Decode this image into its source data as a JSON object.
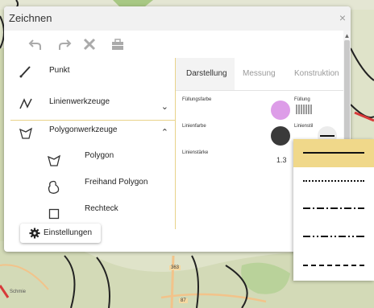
{
  "window": {
    "title": "Zeichnen",
    "close_glyph": "×"
  },
  "toolbar": [
    {
      "name": "undo-icon"
    },
    {
      "name": "redo-icon"
    },
    {
      "name": "delete-icon"
    },
    {
      "name": "toolbox-icon"
    }
  ],
  "tools": {
    "punkt": "Punkt",
    "linien": "Linienwerkzeuge",
    "polygon": "Polygonwerkzeuge",
    "sub": [
      "Polygon",
      "Freihand Polygon",
      "Rechteck"
    ]
  },
  "tabs": [
    "Darstellung",
    "Messung",
    "Konstruktion"
  ],
  "style": {
    "fill_color_label": "Füllungsfarbe",
    "fill_label": "Füllung",
    "line_color_label": "Linienfarbe",
    "line_style_label": "Linienstil",
    "line_width_label": "Linienstärke",
    "line_width_value": "1.3",
    "fill_color": "#dd9de8",
    "line_color": "#3a3a3a"
  },
  "settings_button": {
    "label": "Einstellungen"
  },
  "dropdown": {
    "options": [
      "solid",
      "dotted",
      "dash-dot",
      "dash-dot-dot",
      "dashed"
    ],
    "selected": "solid",
    "highlight": "#f0d88a"
  },
  "map": {
    "road_labels": [
      "363",
      "87"
    ],
    "place_label": "Schmie"
  }
}
